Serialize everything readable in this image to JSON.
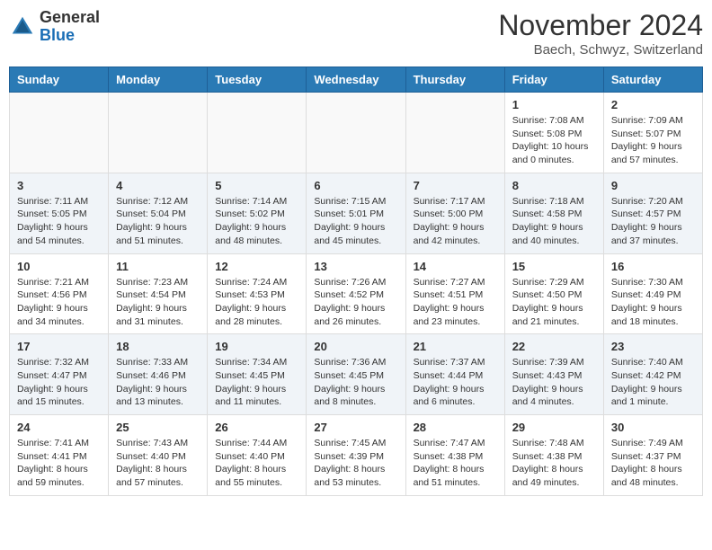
{
  "header": {
    "logo_general": "General",
    "logo_blue": "Blue",
    "month_title": "November 2024",
    "location": "Baech, Schwyz, Switzerland"
  },
  "weekdays": [
    "Sunday",
    "Monday",
    "Tuesday",
    "Wednesday",
    "Thursday",
    "Friday",
    "Saturday"
  ],
  "weeks": [
    [
      {
        "day": "",
        "info": ""
      },
      {
        "day": "",
        "info": ""
      },
      {
        "day": "",
        "info": ""
      },
      {
        "day": "",
        "info": ""
      },
      {
        "day": "",
        "info": ""
      },
      {
        "day": "1",
        "info": "Sunrise: 7:08 AM\nSunset: 5:08 PM\nDaylight: 10 hours\nand 0 minutes."
      },
      {
        "day": "2",
        "info": "Sunrise: 7:09 AM\nSunset: 5:07 PM\nDaylight: 9 hours\nand 57 minutes."
      }
    ],
    [
      {
        "day": "3",
        "info": "Sunrise: 7:11 AM\nSunset: 5:05 PM\nDaylight: 9 hours\nand 54 minutes."
      },
      {
        "day": "4",
        "info": "Sunrise: 7:12 AM\nSunset: 5:04 PM\nDaylight: 9 hours\nand 51 minutes."
      },
      {
        "day": "5",
        "info": "Sunrise: 7:14 AM\nSunset: 5:02 PM\nDaylight: 9 hours\nand 48 minutes."
      },
      {
        "day": "6",
        "info": "Sunrise: 7:15 AM\nSunset: 5:01 PM\nDaylight: 9 hours\nand 45 minutes."
      },
      {
        "day": "7",
        "info": "Sunrise: 7:17 AM\nSunset: 5:00 PM\nDaylight: 9 hours\nand 42 minutes."
      },
      {
        "day": "8",
        "info": "Sunrise: 7:18 AM\nSunset: 4:58 PM\nDaylight: 9 hours\nand 40 minutes."
      },
      {
        "day": "9",
        "info": "Sunrise: 7:20 AM\nSunset: 4:57 PM\nDaylight: 9 hours\nand 37 minutes."
      }
    ],
    [
      {
        "day": "10",
        "info": "Sunrise: 7:21 AM\nSunset: 4:56 PM\nDaylight: 9 hours\nand 34 minutes."
      },
      {
        "day": "11",
        "info": "Sunrise: 7:23 AM\nSunset: 4:54 PM\nDaylight: 9 hours\nand 31 minutes."
      },
      {
        "day": "12",
        "info": "Sunrise: 7:24 AM\nSunset: 4:53 PM\nDaylight: 9 hours\nand 28 minutes."
      },
      {
        "day": "13",
        "info": "Sunrise: 7:26 AM\nSunset: 4:52 PM\nDaylight: 9 hours\nand 26 minutes."
      },
      {
        "day": "14",
        "info": "Sunrise: 7:27 AM\nSunset: 4:51 PM\nDaylight: 9 hours\nand 23 minutes."
      },
      {
        "day": "15",
        "info": "Sunrise: 7:29 AM\nSunset: 4:50 PM\nDaylight: 9 hours\nand 21 minutes."
      },
      {
        "day": "16",
        "info": "Sunrise: 7:30 AM\nSunset: 4:49 PM\nDaylight: 9 hours\nand 18 minutes."
      }
    ],
    [
      {
        "day": "17",
        "info": "Sunrise: 7:32 AM\nSunset: 4:47 PM\nDaylight: 9 hours\nand 15 minutes."
      },
      {
        "day": "18",
        "info": "Sunrise: 7:33 AM\nSunset: 4:46 PM\nDaylight: 9 hours\nand 13 minutes."
      },
      {
        "day": "19",
        "info": "Sunrise: 7:34 AM\nSunset: 4:45 PM\nDaylight: 9 hours\nand 11 minutes."
      },
      {
        "day": "20",
        "info": "Sunrise: 7:36 AM\nSunset: 4:45 PM\nDaylight: 9 hours\nand 8 minutes."
      },
      {
        "day": "21",
        "info": "Sunrise: 7:37 AM\nSunset: 4:44 PM\nDaylight: 9 hours\nand 6 minutes."
      },
      {
        "day": "22",
        "info": "Sunrise: 7:39 AM\nSunset: 4:43 PM\nDaylight: 9 hours\nand 4 minutes."
      },
      {
        "day": "23",
        "info": "Sunrise: 7:40 AM\nSunset: 4:42 PM\nDaylight: 9 hours\nand 1 minute."
      }
    ],
    [
      {
        "day": "24",
        "info": "Sunrise: 7:41 AM\nSunset: 4:41 PM\nDaylight: 8 hours\nand 59 minutes."
      },
      {
        "day": "25",
        "info": "Sunrise: 7:43 AM\nSunset: 4:40 PM\nDaylight: 8 hours\nand 57 minutes."
      },
      {
        "day": "26",
        "info": "Sunrise: 7:44 AM\nSunset: 4:40 PM\nDaylight: 8 hours\nand 55 minutes."
      },
      {
        "day": "27",
        "info": "Sunrise: 7:45 AM\nSunset: 4:39 PM\nDaylight: 8 hours\nand 53 minutes."
      },
      {
        "day": "28",
        "info": "Sunrise: 7:47 AM\nSunset: 4:38 PM\nDaylight: 8 hours\nand 51 minutes."
      },
      {
        "day": "29",
        "info": "Sunrise: 7:48 AM\nSunset: 4:38 PM\nDaylight: 8 hours\nand 49 minutes."
      },
      {
        "day": "30",
        "info": "Sunrise: 7:49 AM\nSunset: 4:37 PM\nDaylight: 8 hours\nand 48 minutes."
      }
    ]
  ]
}
